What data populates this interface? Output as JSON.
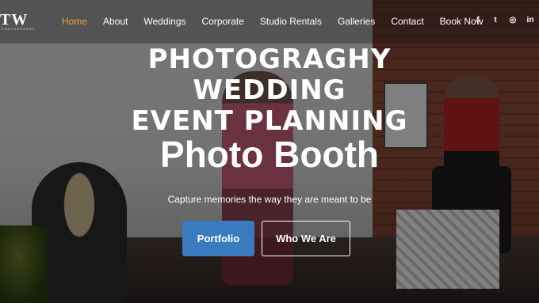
{
  "nav": {
    "logo": "TW",
    "logo_sub": "PHOTOGRAPHY",
    "items": [
      "Home",
      "About",
      "Weddings",
      "Corporate",
      "Studio Rentals",
      "Galleries",
      "Contact",
      "Book Now"
    ],
    "active": "Home",
    "social": {
      "facebook": "f",
      "twitter": "t",
      "instagram": "◎",
      "linkedin": "in"
    }
  },
  "hero": {
    "line1": "PHOTOGRAGHY",
    "line2": "WEDDING",
    "line3": "EVENT PLANNING",
    "line4": "Photo Booth",
    "tagline": "Capture memories the way they are meant to be"
  },
  "buttons": {
    "portfolio": "Portfolio",
    "who_we_are": "Who We Are"
  },
  "colors": {
    "accent": "#e9a23b",
    "primary_button": "#3a7bbf"
  }
}
